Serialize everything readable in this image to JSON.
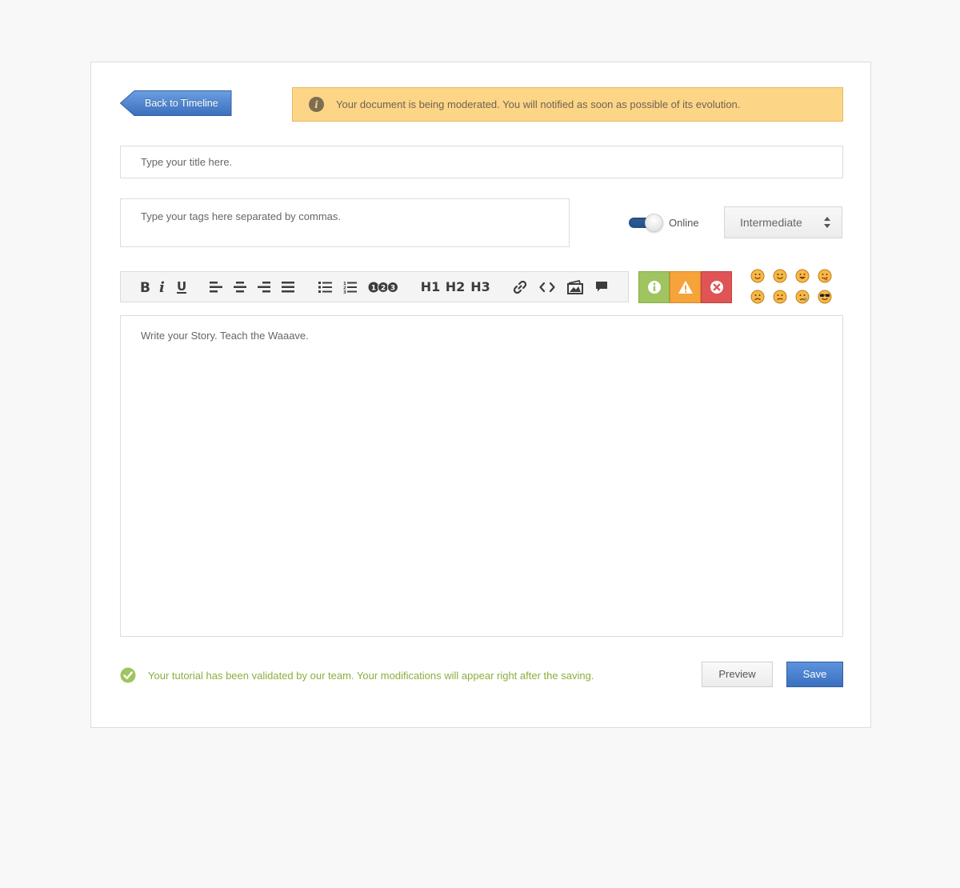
{
  "header": {
    "back_button": "Back to Timeline",
    "notice": "Your document is being moderated. You will notified as soon as possible of its evolution."
  },
  "form": {
    "title_placeholder": "Type your title here.",
    "tags_placeholder": "Type your tags here separated by commas.",
    "online_label": "Online",
    "online_on": true,
    "level_value": "Intermediate",
    "story_placeholder": "Write your Story. Teach the Waaave."
  },
  "toolbar": {
    "items": [
      "bold-icon",
      "italic-icon",
      "underline-icon",
      "align-left-icon",
      "align-center-icon",
      "align-right-icon",
      "align-justify-icon",
      "bullet-list-icon",
      "numbered-list-icon",
      "steps-icon",
      "link-icon",
      "code-icon",
      "image-icon",
      "comment-icon"
    ],
    "h1": "H1",
    "h2": "H2",
    "h3": "H3",
    "steps": [
      "1",
      "2",
      "3"
    ],
    "callouts": [
      {
        "name": "info-callout",
        "color": "#9fc460"
      },
      {
        "name": "warning-callout",
        "color": "#f6a33a"
      },
      {
        "name": "error-callout",
        "color": "#df5454"
      }
    ],
    "emojis": [
      "smile",
      "wink",
      "grin",
      "tongue",
      "sad",
      "confused",
      "cry",
      "cool"
    ]
  },
  "footer": {
    "validation_message": "Your tutorial has been validated by our team. Your modifications will appear right after the saving.",
    "preview_label": "Preview",
    "save_label": "Save"
  },
  "colors": {
    "accent_blue": "#3a70bf",
    "notice_bg": "#fdd586",
    "success_green": "#8aaf3f"
  }
}
